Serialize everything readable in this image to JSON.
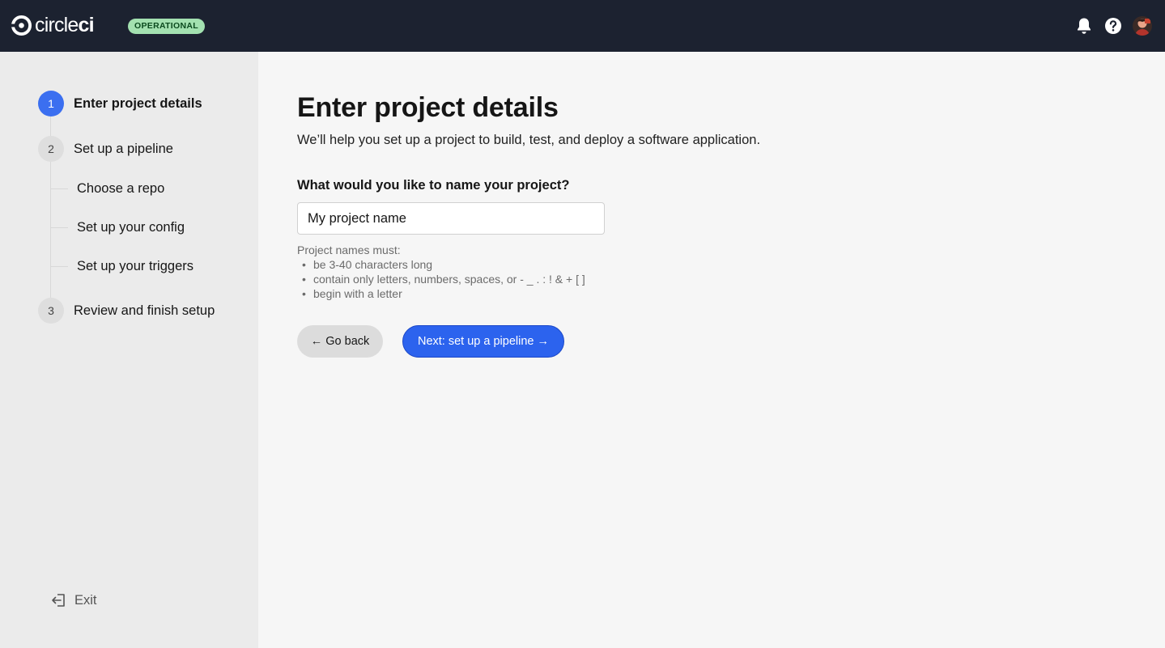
{
  "header": {
    "brand_light": "circle",
    "brand_bold": "ci",
    "status_badge": "OPERATIONAL",
    "icons": [
      "bell-icon",
      "help-icon",
      "user-avatar"
    ],
    "colors": {
      "bar": "#1c2230",
      "badge_bg": "#a3e1b0",
      "badge_text": "#0b4a1e"
    }
  },
  "sidebar": {
    "steps": [
      {
        "number": "1",
        "label": "Enter project details",
        "active": true
      },
      {
        "number": "2",
        "label": "Set up a pipeline",
        "active": false
      },
      {
        "number": "3",
        "label": "Review and finish setup",
        "active": false
      }
    ],
    "substeps": [
      "Choose a repo",
      "Set up your config",
      "Set up your triggers"
    ],
    "exit_label": "Exit"
  },
  "main": {
    "title": "Enter project details",
    "subtitle": "We’ll help you set up a project to build, test, and deploy a software application.",
    "field_label": "What would you like to name your project?",
    "input_value": "My project name",
    "rules_heading": "Project names must:",
    "rules": [
      "be 3-40 characters long",
      "contain only letters, numbers, spaces, or - _ . : ! & + [ ]",
      "begin with a letter"
    ],
    "back_button": "← Go back",
    "next_button": "Next: set up a pipeline →",
    "colors": {
      "primary": "#2c63ee",
      "active_step": "#3b6ff0"
    }
  }
}
